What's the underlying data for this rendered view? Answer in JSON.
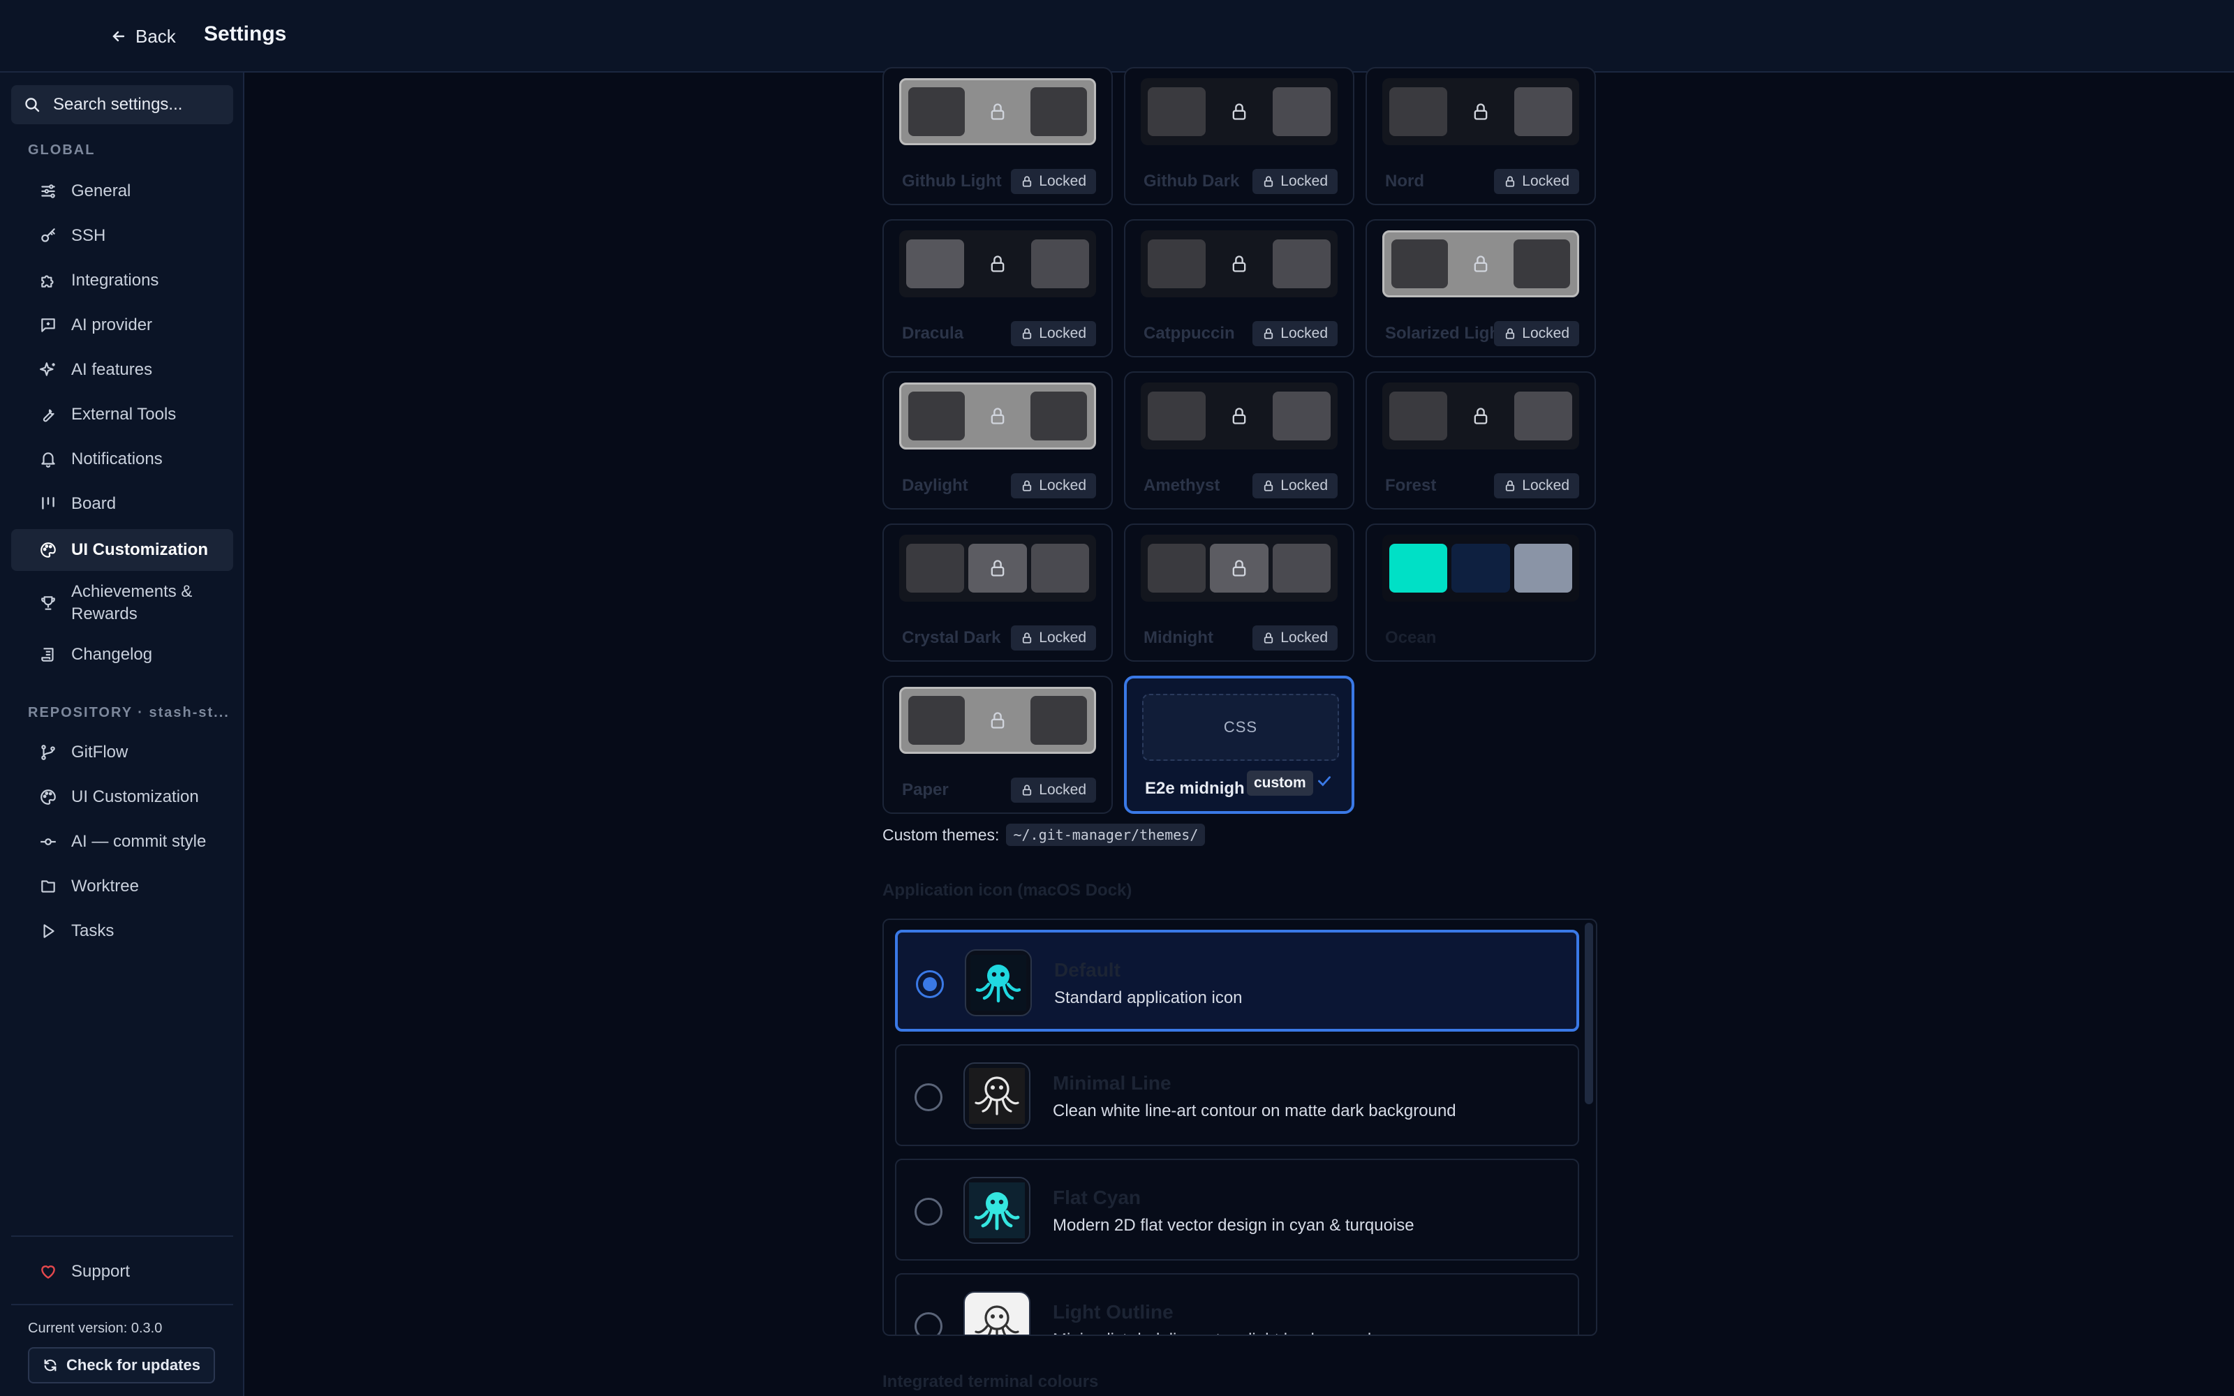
{
  "header": {
    "back_label": "Back",
    "title": "Settings"
  },
  "sidebar": {
    "search_placeholder": "Search settings...",
    "global_label": "GLOBAL",
    "global_items": [
      {
        "label": "General",
        "icon": "sliders-icon"
      },
      {
        "label": "SSH",
        "icon": "key-icon"
      },
      {
        "label": "Integrations",
        "icon": "puzzle-icon"
      },
      {
        "label": "AI provider",
        "icon": "chat-icon"
      },
      {
        "label": "AI features",
        "icon": "sparkles-icon"
      },
      {
        "label": "External Tools",
        "icon": "wrench-icon"
      },
      {
        "label": "Notifications",
        "icon": "bell-icon"
      },
      {
        "label": "Board",
        "icon": "board-icon"
      },
      {
        "label": "UI Customization",
        "icon": "palette-icon",
        "active": true
      },
      {
        "label": "Achievements & Rewards",
        "icon": "trophy-icon"
      },
      {
        "label": "Changelog",
        "icon": "scroll-icon"
      }
    ],
    "repo_label": "REPOSITORY · stash-st...",
    "repo_items": [
      {
        "label": "GitFlow",
        "icon": "git-branch-icon"
      },
      {
        "label": "UI Customization",
        "icon": "palette-icon"
      },
      {
        "label": "AI — commit style",
        "icon": "commit-icon"
      },
      {
        "label": "Worktree",
        "icon": "tree-icon"
      },
      {
        "label": "Tasks",
        "icon": "play-icon"
      }
    ],
    "support_label": "Support",
    "version_text": "Current version: 0.3.0",
    "update_label": "Check for updates"
  },
  "themes": {
    "locked_label": "Locked",
    "cards": [
      {
        "name": "Github Light",
        "locked": true
      },
      {
        "name": "Github Dark",
        "locked": true
      },
      {
        "name": "Nord",
        "locked": true
      },
      {
        "name": "Dracula",
        "locked": true
      },
      {
        "name": "Catppuccin",
        "locked": true
      },
      {
        "name": "Solarized Light",
        "locked": true
      },
      {
        "name": "Daylight",
        "locked": true
      },
      {
        "name": "Amethyst",
        "locked": true
      },
      {
        "name": "Forest",
        "locked": true
      },
      {
        "name": "Crystal Dark",
        "locked": true
      },
      {
        "name": "Midnight",
        "locked": true
      },
      {
        "name": "Ocean",
        "locked": false,
        "colors": [
          "#00e0c6",
          "#0e2040",
          "#8a94a6"
        ]
      },
      {
        "name": "Paper",
        "locked": true
      },
      {
        "name": "E2e midnigh",
        "custom": true,
        "selected": true,
        "preview": "CSS",
        "badge": "custom"
      }
    ],
    "custom_prefix": "Custom themes:",
    "custom_path": "~/.git-manager/themes/"
  },
  "app_icon": {
    "heading": "Application icon (macOS Dock)",
    "options": [
      {
        "title": "Default",
        "desc": "Standard application icon",
        "selected": true
      },
      {
        "title": "Minimal Line",
        "desc": "Clean white line-art contour on matte dark background"
      },
      {
        "title": "Flat Cyan",
        "desc": "Modern 2D flat vector design in cyan & turquoise"
      },
      {
        "title": "Light Outline",
        "desc": "Minimalist dark line-art on light background"
      }
    ]
  },
  "terminal": {
    "heading": "Integrated terminal colours"
  },
  "colors": {
    "accent": "#3a79e6",
    "ocean_teal": "#00e0c6",
    "heart": "#e5484d"
  }
}
